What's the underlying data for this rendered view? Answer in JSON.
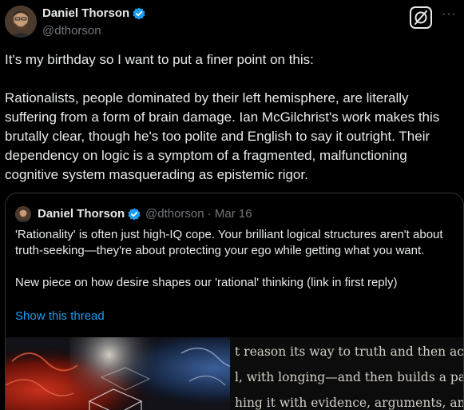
{
  "tweet": {
    "author_name": "Daniel Thorson",
    "author_handle": "@dthorson",
    "text": "It's my birthday so I want to put a finer point on this:\n\nRationalists, people dominated by their left hemisphere, are literally suffering from a form of brain damage. Ian McGilchrist's work makes this brutally clear, though he's too polite and English to say it outright. Their dependency on logic is a symptom of a fragmented, malfunctioning cognitive system masquerading as epistemic rigor.",
    "more_icon": "···"
  },
  "quoted": {
    "author_name": "Daniel Thorson",
    "handle_date": "@dthorson · Mar 16",
    "text": "'Rationality' is often just high-IQ cope. Your brilliant logical structures aren't about truth-seeking—they're about protecting your ego while getting what you want.\n\nNew piece on how desire shapes our 'rational' thinking (link in first reply)",
    "show_thread": "Show this thread",
    "media_text": [
      "t reason its way to truth and then act.",
      "l, with longing—and then builds a pal",
      "hing it with evidence, arguments, and"
    ]
  },
  "colors": {
    "background": "#000000",
    "text": "#e7e9ea",
    "secondary": "#71767b",
    "link": "#1d9bf0",
    "verified": "#1d9bf0",
    "border": "#2f3336"
  }
}
